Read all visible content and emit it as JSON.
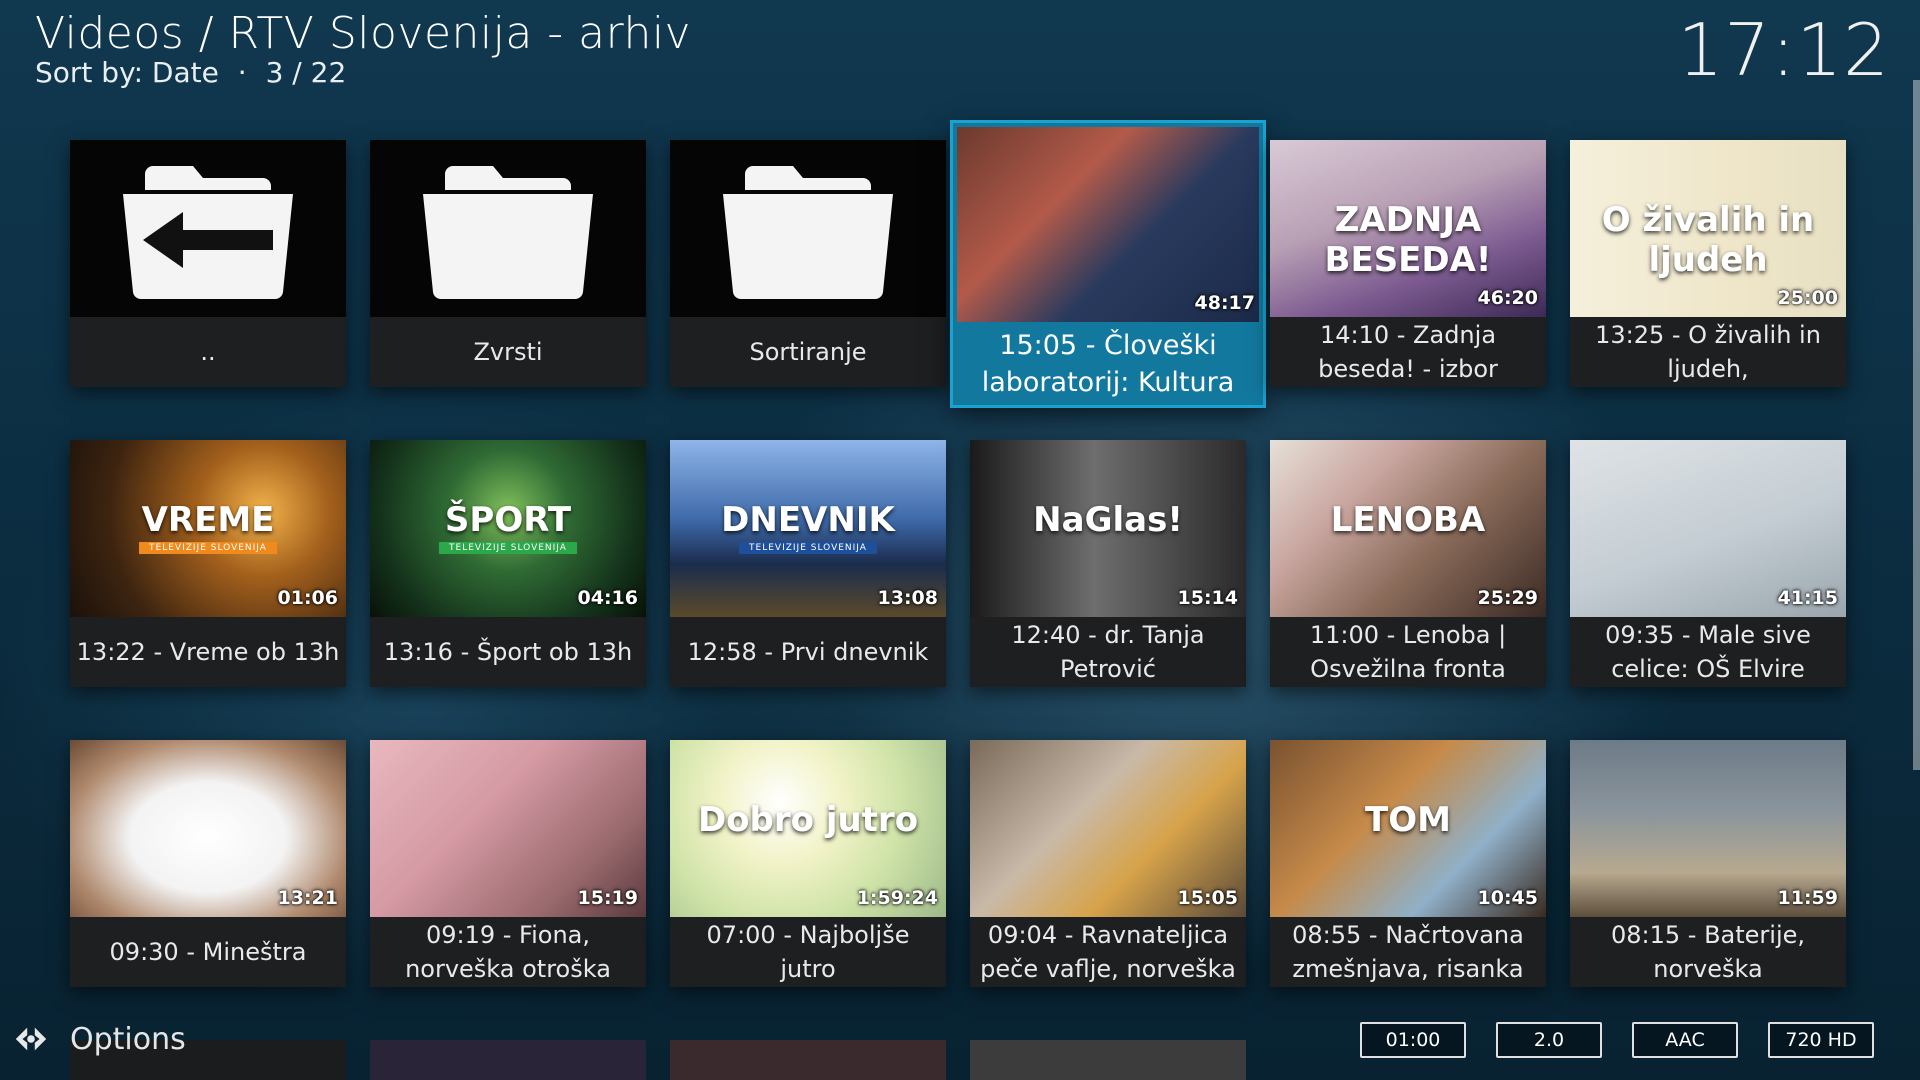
{
  "header": {
    "title": "Videos / RTV Slovenija - arhiv",
    "sort_label": "Sort by: Date",
    "separator": "·",
    "position": "3 / 22"
  },
  "clock": "17:12",
  "tiles": [
    {
      "label": "..",
      "duration": "",
      "kind": "folder-back",
      "art": ""
    },
    {
      "label": "Zvrsti",
      "duration": "",
      "kind": "folder",
      "art": ""
    },
    {
      "label": "Sortiranje",
      "duration": "",
      "kind": "folder",
      "art": ""
    },
    {
      "label": "15:05 - Človeški laboratorij: Kultura",
      "duration": "48:17",
      "kind": "video",
      "art": "art-people",
      "focused": true
    },
    {
      "label": "14:10 - Zadnja beseda! - izbor",
      "duration": "46:20",
      "kind": "video",
      "art": "art-beseda",
      "logo": "ZADNJA BESEDA!"
    },
    {
      "label": "13:25 - O živalih in ljudeh,",
      "duration": "25:00",
      "kind": "video",
      "art": "art-zivali",
      "logo": "O živalih in ljudeh"
    },
    {
      "label": "13:22 - Vreme ob 13h",
      "duration": "01:06",
      "kind": "video",
      "art": "art-vreme",
      "logo": "VREME",
      "logo_sub": "TELEVIZIJE SLOVENIJA",
      "logo_color": "#f08a1c"
    },
    {
      "label": "13:16 - Šport ob 13h",
      "duration": "04:16",
      "kind": "video",
      "art": "art-sport",
      "logo": "ŠPORT",
      "logo_sub": "TELEVIZIJE SLOVENIJA",
      "logo_color": "#2aa84a"
    },
    {
      "label": "12:58 - Prvi dnevnik",
      "duration": "13:08",
      "kind": "video",
      "art": "art-dnevnik",
      "logo": "DNEVNIK",
      "logo_sub": "TELEVIZIJE SLOVENIJA",
      "logo_color": "#1d4f9a"
    },
    {
      "label": "12:40 - dr. Tanja Petrović",
      "duration": "15:14",
      "kind": "video",
      "art": "art-naglas",
      "logo": "NaGlas!"
    },
    {
      "label": "11:00 - Lenoba | Osvežilna fronta",
      "duration": "25:29",
      "kind": "video",
      "art": "art-lenoba",
      "logo": "LENOBA"
    },
    {
      "label": "09:35 - Male sive celice: OŠ Elvire",
      "duration": "41:15",
      "kind": "video",
      "art": "art-sive"
    },
    {
      "label": "09:30 - Mineštra",
      "duration": "13:21",
      "kind": "video",
      "art": "art-salad"
    },
    {
      "label": "09:19 - Fiona, norveška otroška",
      "duration": "15:19",
      "kind": "video",
      "art": "art-fiona"
    },
    {
      "label": "07:00 - Najboljše jutro",
      "duration": "1:59:24",
      "kind": "video",
      "art": "art-jutro",
      "logo": "Dobro jutro"
    },
    {
      "label": "09:04 - Ravnateljica peče vaflje, norveška",
      "duration": "15:05",
      "kind": "video",
      "art": "art-ravn"
    },
    {
      "label": "08:55 - Načrtovana zmešnjava, risanka",
      "duration": "10:45",
      "kind": "video",
      "art": "art-tom",
      "logo": "TOM"
    },
    {
      "label": "08:15 - Baterije, norveška",
      "duration": "11:59",
      "kind": "video",
      "art": "art-baterije"
    }
  ],
  "footer": {
    "options_label": "Options",
    "flags": [
      "01:00",
      "2.0",
      "AAC",
      "720 HD"
    ]
  },
  "colors": {
    "focus": "#13789e",
    "focus_border": "#1aa3d1"
  }
}
